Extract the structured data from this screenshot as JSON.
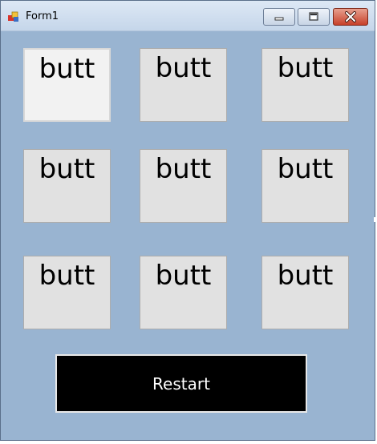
{
  "window": {
    "title": "Form1",
    "icons": {
      "app": "app-icon",
      "minimize": "minimize-icon",
      "maximize": "maximize-icon",
      "close": "close-icon"
    }
  },
  "grid": {
    "buttons": [
      {
        "label": "butt"
      },
      {
        "label": "butt"
      },
      {
        "label": "butt"
      },
      {
        "label": "butt"
      },
      {
        "label": "butt"
      },
      {
        "label": "butt"
      },
      {
        "label": "butt"
      },
      {
        "label": "butt"
      },
      {
        "label": "butt"
      }
    ]
  },
  "restart": {
    "label": "Restart"
  },
  "colors": {
    "form_background": "#99b4d1",
    "button_face": "#e1e1e1",
    "restart_background": "#000000",
    "close_button": "#c7412a"
  }
}
